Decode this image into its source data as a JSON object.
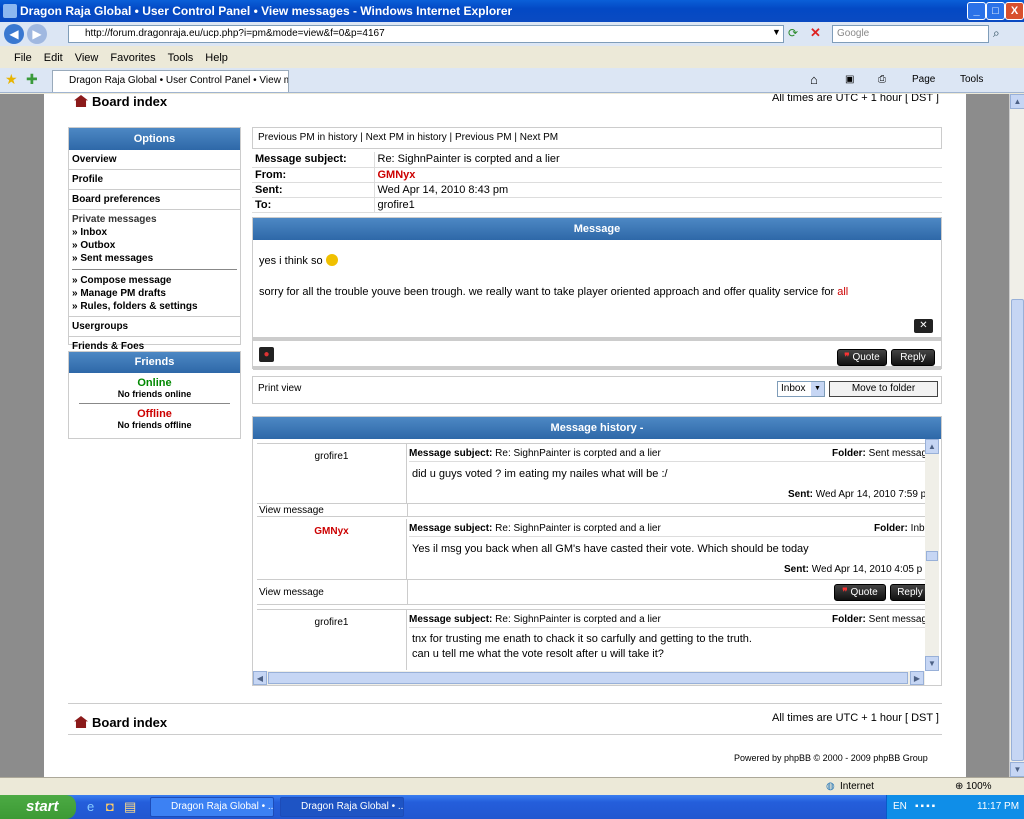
{
  "window": {
    "title": "Dragon Raja Global • User Control Panel • View messages - Windows Internet Explorer",
    "min": "_",
    "max": "□",
    "close": "X"
  },
  "address": {
    "url": "http://forum.dragonraja.eu/ucp.php?i=pm&mode=view&f=0&p=4167",
    "search_placeholder": "Google"
  },
  "menu": [
    "File",
    "Edit",
    "View",
    "Favorites",
    "Tools",
    "Help"
  ],
  "tab": {
    "label": "Dragon Raja Global • User Control Panel • View messa..."
  },
  "toolbar": {
    "page": "Page",
    "tools": "Tools"
  },
  "board": {
    "index": "Board index",
    "times": "All times are UTC + 1 hour [ DST ]",
    "powered": "Powered by phpBB © 2000 - 2009 phpBB Group"
  },
  "options": {
    "heading": "Options",
    "items": [
      "Overview",
      "Profile",
      "Board preferences"
    ],
    "pm_heading": "Private messages",
    "pm_items": [
      "» Inbox",
      "» Outbox",
      "» Sent messages"
    ],
    "pm_items2": [
      "» Compose message",
      "» Manage PM drafts",
      "» Rules, folders & settings"
    ],
    "more": [
      "Usergroups",
      "Friends & Foes"
    ]
  },
  "friends": {
    "heading": "Friends",
    "online": "Online",
    "no_online": "No friends online",
    "offline": "Offline",
    "no_offline": "No friends offline"
  },
  "pmnav": {
    "prev_history": "Previous PM in history",
    "next_history": "Next PM in history",
    "prev": "Previous PM",
    "next": "Next PM"
  },
  "message": {
    "subject_label": "Message subject:",
    "subject": "Re: SighnPainter is corpted and a lier",
    "from_label": "From:",
    "from": "GMNyx",
    "sent_label": "Sent:",
    "sent": "Wed Apr 14, 2010 8:43 pm",
    "to_label": "To:",
    "to": "grofire1",
    "heading": "Message",
    "line1": "yes i think so",
    "line2": "sorry for all the trouble youve been trough. we really want to take player oriented approach and offer quality service for",
    "line2_link": "all",
    "quote": "Quote",
    "reply": "Reply"
  },
  "folder": {
    "print": "Print view",
    "select": "Inbox",
    "move": "Move to folder"
  },
  "history": {
    "heading": "Message history",
    "heading_suffix": "-",
    "entries": [
      {
        "author": "grofire1",
        "subject_label": "Message subject:",
        "subject": "Re: SighnPainter is corpted and a lier",
        "folder_label": "Folder:",
        "folder": "Sent messag",
        "body": [
          "did u guys voted ? im eating my nailes what will be :/"
        ],
        "sent_label": "Sent:",
        "sent": "Wed Apr 14, 2010 7:59 p",
        "view": "View message"
      },
      {
        "author": "GMNyx",
        "subject_label": "Message subject:",
        "subject": "Re: SighnPainter is corpted and a lier",
        "folder_label": "Folder:",
        "folder": "Inb",
        "body": [
          "Yes il msg you back when all GM's have casted their vote. Which should be today"
        ],
        "sent_label": "Sent:",
        "sent": "Wed Apr 14, 2010 4:05 p",
        "view": "View message",
        "quote": "Quote",
        "reply": "Reply"
      },
      {
        "author": "grofire1",
        "subject_label": "Message subject:",
        "subject": "Re: SighnPainter is corpted and a lier",
        "folder_label": "Folder:",
        "folder": "Sent messag",
        "body": [
          "tnx for trusting me enath to chack it so carfully and getting to the truth.",
          "can u tell me what the vote resolt after u will take it?"
        ]
      }
    ]
  },
  "status": {
    "zone": "Internet",
    "zoom": "100%"
  },
  "taskbar": {
    "start": "start",
    "task1": "Dragon Raja Global • ...",
    "task2": "Dragon Raja Global • ...",
    "lang": "EN",
    "time": "11:17 PM"
  }
}
